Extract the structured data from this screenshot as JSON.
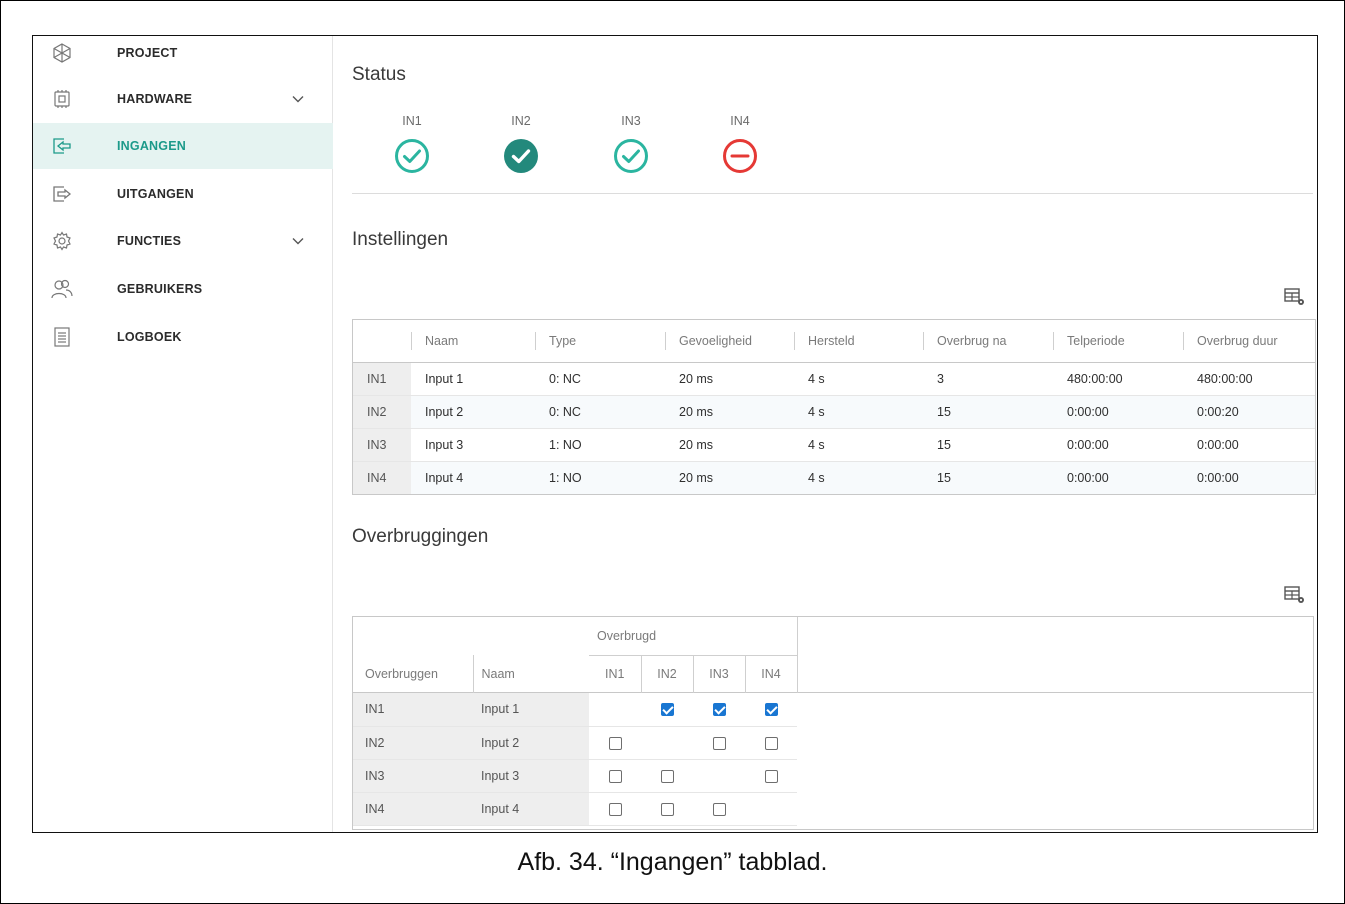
{
  "sidebar": {
    "items": [
      {
        "label": "PROJECT",
        "icon": "project-icon"
      },
      {
        "label": "HARDWARE",
        "icon": "chip-icon",
        "expandable": true
      },
      {
        "label": "INGANGEN",
        "icon": "input-icon",
        "active": true
      },
      {
        "label": "UITGANGEN",
        "icon": "output-icon"
      },
      {
        "label": "FUNCTIES",
        "icon": "gear-icon",
        "expandable": true
      },
      {
        "label": "GEBRUIKERS",
        "icon": "users-icon"
      },
      {
        "label": "LOGBOEK",
        "icon": "log-icon"
      }
    ]
  },
  "status": {
    "title": "Status",
    "items": [
      {
        "label": "IN1",
        "state": "ok-outline",
        "color": "#2bb5a0"
      },
      {
        "label": "IN2",
        "state": "ok-filled",
        "color": "#23897c"
      },
      {
        "label": "IN3",
        "state": "ok-outline",
        "color": "#2bb5a0"
      },
      {
        "label": "IN4",
        "state": "blocked",
        "color": "#e53935"
      }
    ]
  },
  "settings": {
    "title": "Instellingen",
    "columns": [
      "",
      "Naam",
      "Type",
      "Gevoeligheid",
      "Hersteld",
      "Overbrug na",
      "Telperiode",
      "Overbrug duur"
    ],
    "rows": [
      [
        "IN1",
        "Input 1",
        "0: NC",
        "20 ms",
        "4 s",
        "3",
        "480:00:00",
        "480:00:00"
      ],
      [
        "IN2",
        "Input 2",
        "0: NC",
        "20 ms",
        "4 s",
        "15",
        "0:00:00",
        "0:00:20"
      ],
      [
        "IN3",
        "Input 3",
        "1: NO",
        "20 ms",
        "4 s",
        "15",
        "0:00:00",
        "0:00:00"
      ],
      [
        "IN4",
        "Input 4",
        "1: NO",
        "20 ms",
        "4 s",
        "15",
        "0:00:00",
        "0:00:00"
      ]
    ]
  },
  "bridging": {
    "title": "Overbruggingen",
    "group_header": "Overbrugd",
    "columns": [
      "Overbruggen",
      "Naam",
      "IN1",
      "IN2",
      "IN3",
      "IN4"
    ],
    "rows": [
      {
        "id": "IN1",
        "name": "Input 1",
        "checks": [
          null,
          true,
          true,
          true
        ]
      },
      {
        "id": "IN2",
        "name": "Input 2",
        "checks": [
          false,
          null,
          false,
          false
        ]
      },
      {
        "id": "IN3",
        "name": "Input 3",
        "checks": [
          false,
          false,
          null,
          false
        ]
      },
      {
        "id": "IN4",
        "name": "Input 4",
        "checks": [
          false,
          false,
          false,
          null
        ]
      }
    ]
  },
  "caption": "Afb. 34. “Ingangen” tabblad.",
  "colors": {
    "accent": "#1c9a8a",
    "active_bg": "#e5f3f1",
    "checkbox": "#1976d2"
  }
}
